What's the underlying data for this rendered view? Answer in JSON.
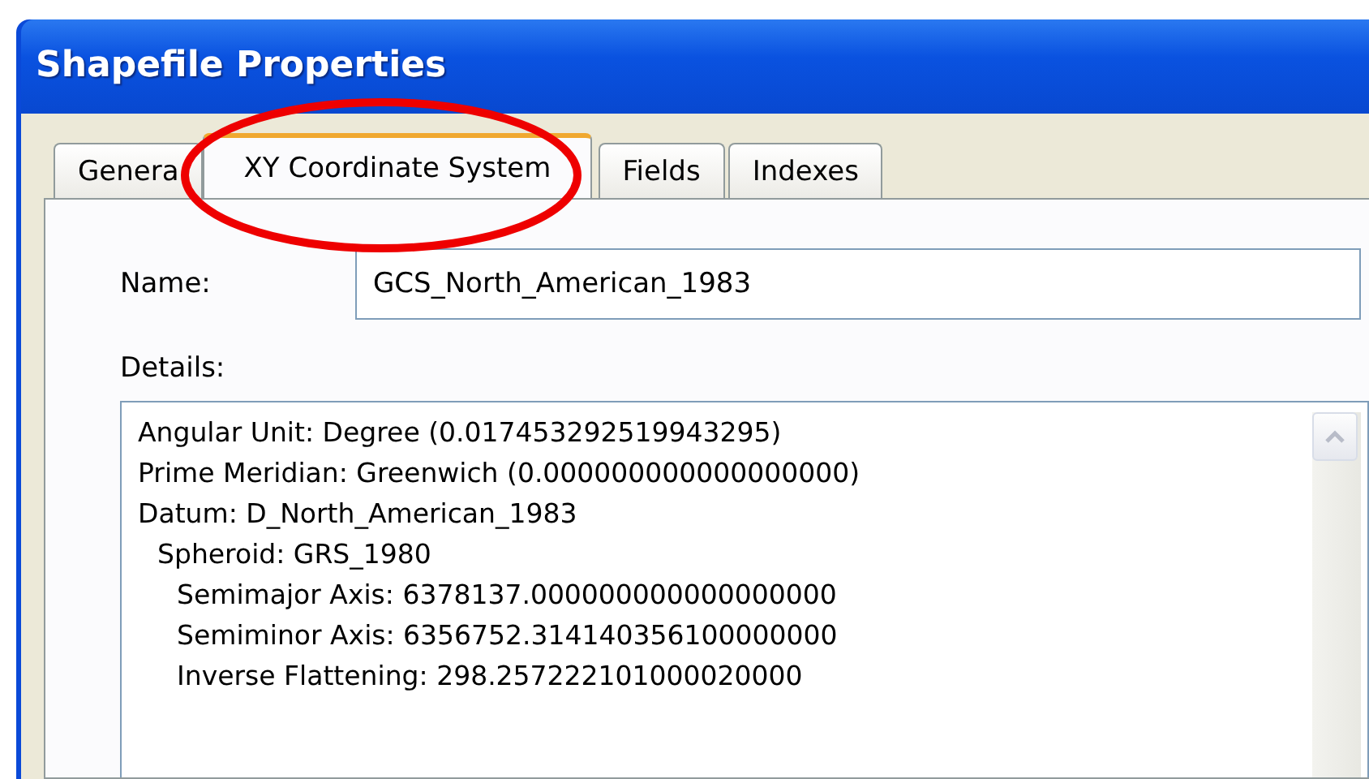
{
  "window": {
    "title": "Shapefile Properties"
  },
  "tabs": [
    {
      "label": "Genera",
      "selected": false
    },
    {
      "label": "XY Coordinate System",
      "selected": true
    },
    {
      "label": "Fields",
      "selected": false
    },
    {
      "label": "Indexes",
      "selected": false
    }
  ],
  "annotation": {
    "kind": "ellipse",
    "color": "#ee0000"
  },
  "name_field": {
    "label": "Name:",
    "value": "GCS_North_American_1983"
  },
  "details": {
    "label": "Details:",
    "lines": [
      {
        "text": "Angular Unit: Degree (0.017453292519943295)"
      },
      {
        "text": "Prime Meridian: Greenwich (0.000000000000000000)"
      },
      {
        "text": "Datum: D_North_American_1983",
        "children": [
          {
            "text": "Spheroid: GRS_1980",
            "children": [
              {
                "text": "Semimajor Axis: 6378137.000000000000000000"
              },
              {
                "text": "Semiminor Axis: 6356752.314140356100000000"
              },
              {
                "text": "Inverse Flattening: 298.257222101000020000"
              }
            ]
          }
        ]
      }
    ]
  }
}
